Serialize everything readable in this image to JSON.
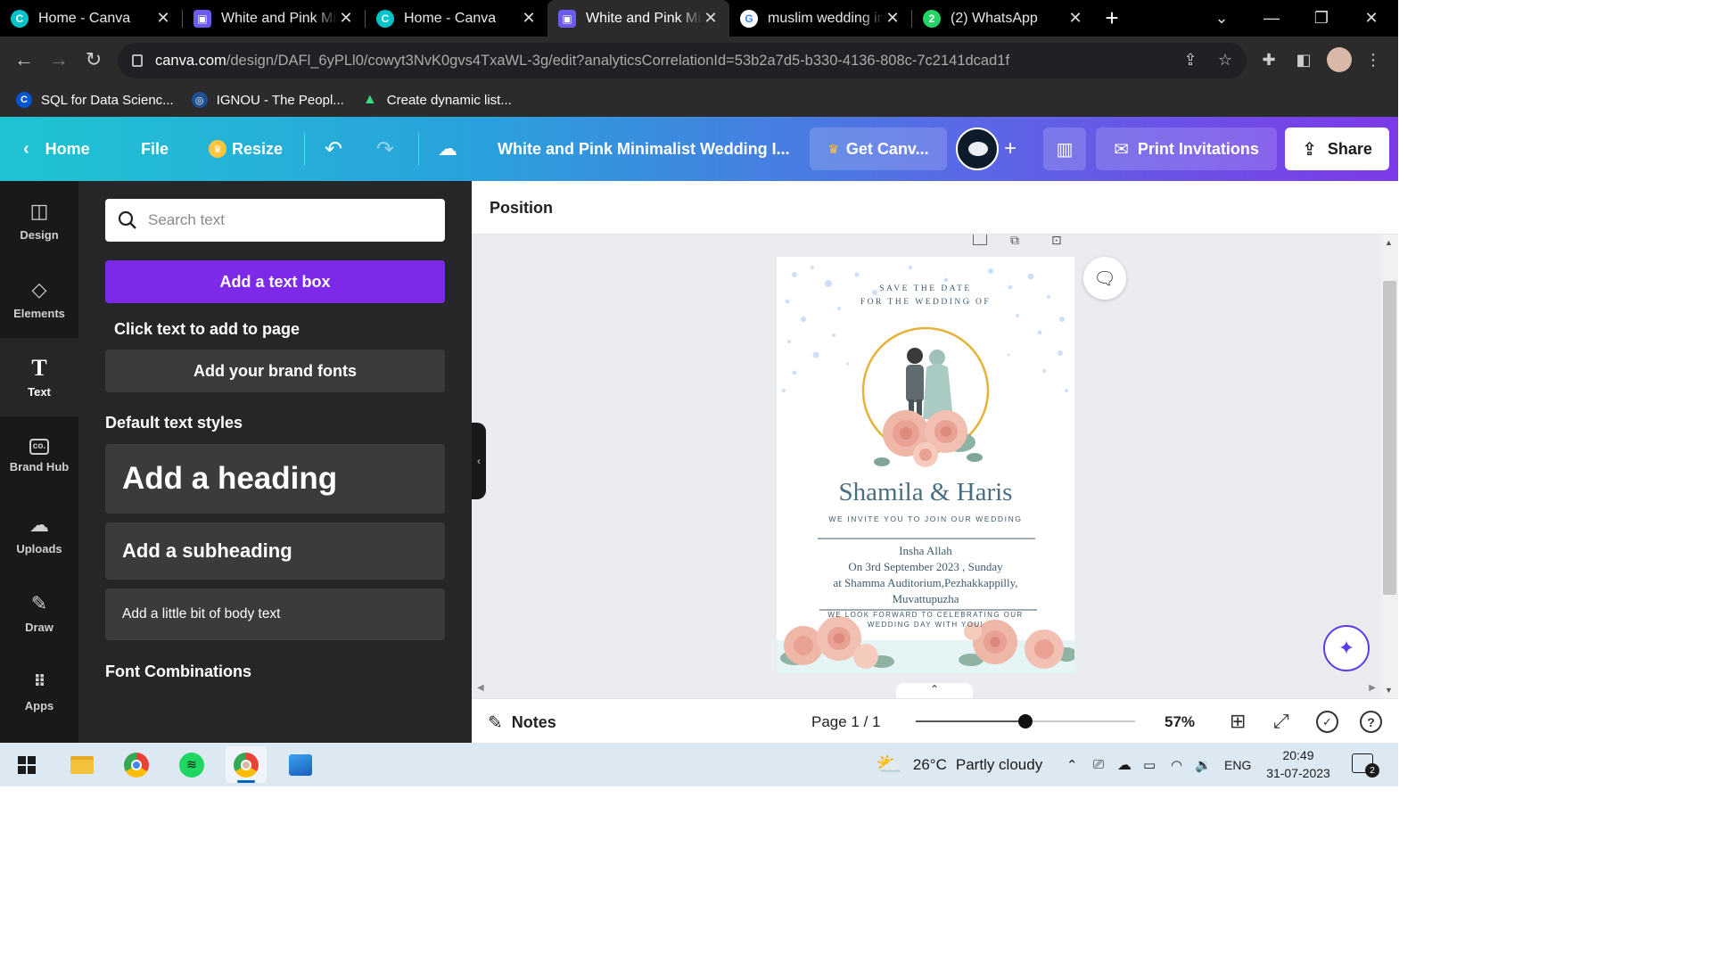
{
  "browser": {
    "tabs": [
      {
        "title": "Home - Canva",
        "icon": "canva-icon",
        "active": false
      },
      {
        "title": "White and Pink Minimalist Wedding Invitation",
        "icon": "canva-doc-icon",
        "active": false
      },
      {
        "title": "Home - Canva",
        "icon": "canva-icon",
        "active": false
      },
      {
        "title": "White and Pink Minimalist Wedding Invitation",
        "icon": "canva-doc-icon",
        "active": true
      },
      {
        "title": "muslim wedding invitation - Google Search",
        "icon": "google-icon",
        "active": false
      },
      {
        "title": "(2) WhatsApp",
        "icon": "whatsapp-icon",
        "active": false
      }
    ],
    "url_host": "canva.com",
    "url_path": "/design/DAFl_6yPLl0/cowyt3NvK0gvs4TxaWL-3g/edit?analyticsCorrelationId=53b2a7d5-b330-4136-808c-7c2141dcad1f",
    "bookmarks": [
      {
        "label": "SQL for Data Scienc...",
        "icon": "coursera-icon"
      },
      {
        "label": "IGNOU - The Peopl...",
        "icon": "ignou-icon"
      },
      {
        "label": "Create dynamic list...",
        "icon": "android-icon"
      }
    ]
  },
  "canva_header": {
    "home_label": "Home",
    "file_label": "File",
    "resize_label": "Resize",
    "doc_title": "White and Pink Minimalist Wedding I...",
    "get_canva_label": "Get Canv...",
    "print_label": "Print Invitations",
    "share_label": "Share"
  },
  "rail": [
    {
      "label": "Design",
      "icon": "layout-icon"
    },
    {
      "label": "Elements",
      "icon": "shapes-icon"
    },
    {
      "label": "Text",
      "icon": "text-icon",
      "active": true
    },
    {
      "label": "Brand Hub",
      "icon": "brand-hub-icon"
    },
    {
      "label": "Uploads",
      "icon": "upload-cloud-icon"
    },
    {
      "label": "Draw",
      "icon": "draw-icon"
    },
    {
      "label": "Apps",
      "icon": "apps-grid-icon"
    }
  ],
  "panel": {
    "search_placeholder": "Search text",
    "add_textbox": "Add a text box",
    "click_hint": "Click text to add to page",
    "brand_fonts": "Add your brand fonts",
    "default_styles": "Default text styles",
    "heading": "Add a heading",
    "subheading": "Add a subheading",
    "body": "Add a little bit of body text",
    "font_combinations": "Font Combinations"
  },
  "editor": {
    "position_label": "Position",
    "notes_label": "Notes",
    "page_indicator": "Page 1 / 1",
    "zoom": "57%",
    "zoom_fraction": 0.57
  },
  "invitation": {
    "save_the_date": "SAVE THE DATE",
    "for_wedding": "FOR THE WEDDING OF",
    "names": "Shamila & Haris",
    "invite_line": "WE INVITE YOU TO JOIN OUR WEDDING",
    "line1": "Insha Allah",
    "line2": "On 3rd September 2023 , Sunday",
    "line3": "at Shamma Auditorium,Pezhakkappilly,",
    "line4": "Muvattupuzha",
    "closing1": "WE LOOK FORWARD TO CELEBRATING OUR",
    "closing2": "WEDDING DAY WITH YOU!"
  },
  "taskbar": {
    "weather_temp": "26°C",
    "weather_text": "Partly cloudy",
    "language": "ENG",
    "time": "20:49",
    "date": "31-07-2023",
    "notification_count": "2"
  },
  "colors": {
    "canva_purple": "#7d2ae8",
    "canva_teal": "#1fc4d3",
    "invite_text": "#3d5a6c",
    "gold_ring": "#e3b33a",
    "rose": "#efb7a8"
  }
}
